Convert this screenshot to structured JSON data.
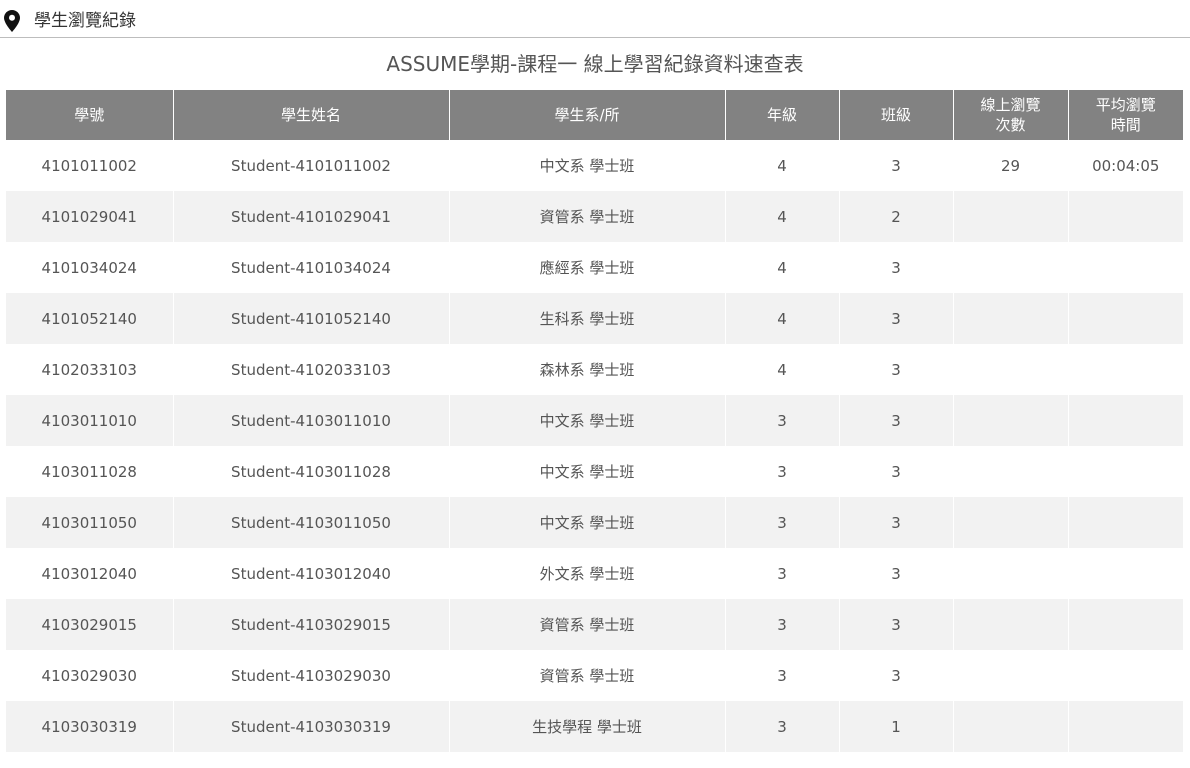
{
  "breadcrumb": {
    "icon": "location-pin-icon",
    "label": "學生瀏覽紀錄"
  },
  "page": {
    "title": "ASSUME學期-課程一 線上學習紀錄資料速查表"
  },
  "table": {
    "headers": {
      "student_id": "學號",
      "student_name": "學生姓名",
      "department": "學生系/所",
      "grade": "年級",
      "class": "班級",
      "views_line1": "線上瀏覽",
      "views_line2": "次數",
      "avg_time_line1": "平均瀏覽",
      "avg_time_line2": "時間"
    },
    "rows": [
      {
        "id": "4101011002",
        "name": "Student-4101011002",
        "dept": "中文系 學士班",
        "grade": "4",
        "class": "3",
        "views": "29",
        "avg_time": "00:04:05"
      },
      {
        "id": "4101029041",
        "name": "Student-4101029041",
        "dept": "資管系 學士班",
        "grade": "4",
        "class": "2",
        "views": "",
        "avg_time": ""
      },
      {
        "id": "4101034024",
        "name": "Student-4101034024",
        "dept": "應經系 學士班",
        "grade": "4",
        "class": "3",
        "views": "",
        "avg_time": ""
      },
      {
        "id": "4101052140",
        "name": "Student-4101052140",
        "dept": "生科系 學士班",
        "grade": "4",
        "class": "3",
        "views": "",
        "avg_time": ""
      },
      {
        "id": "4102033103",
        "name": "Student-4102033103",
        "dept": "森林系 學士班",
        "grade": "4",
        "class": "3",
        "views": "",
        "avg_time": ""
      },
      {
        "id": "4103011010",
        "name": "Student-4103011010",
        "dept": "中文系 學士班",
        "grade": "3",
        "class": "3",
        "views": "",
        "avg_time": ""
      },
      {
        "id": "4103011028",
        "name": "Student-4103011028",
        "dept": "中文系 學士班",
        "grade": "3",
        "class": "3",
        "views": "",
        "avg_time": ""
      },
      {
        "id": "4103011050",
        "name": "Student-4103011050",
        "dept": "中文系 學士班",
        "grade": "3",
        "class": "3",
        "views": "",
        "avg_time": ""
      },
      {
        "id": "4103012040",
        "name": "Student-4103012040",
        "dept": "外文系 學士班",
        "grade": "3",
        "class": "3",
        "views": "",
        "avg_time": ""
      },
      {
        "id": "4103029015",
        "name": "Student-4103029015",
        "dept": "資管系 學士班",
        "grade": "3",
        "class": "3",
        "views": "",
        "avg_time": ""
      },
      {
        "id": "4103029030",
        "name": "Student-4103029030",
        "dept": "資管系 學士班",
        "grade": "3",
        "class": "3",
        "views": "",
        "avg_time": ""
      },
      {
        "id": "4103030319",
        "name": "Student-4103030319",
        "dept": "生技學程 學士班",
        "grade": "3",
        "class": "1",
        "views": "",
        "avg_time": ""
      }
    ]
  }
}
